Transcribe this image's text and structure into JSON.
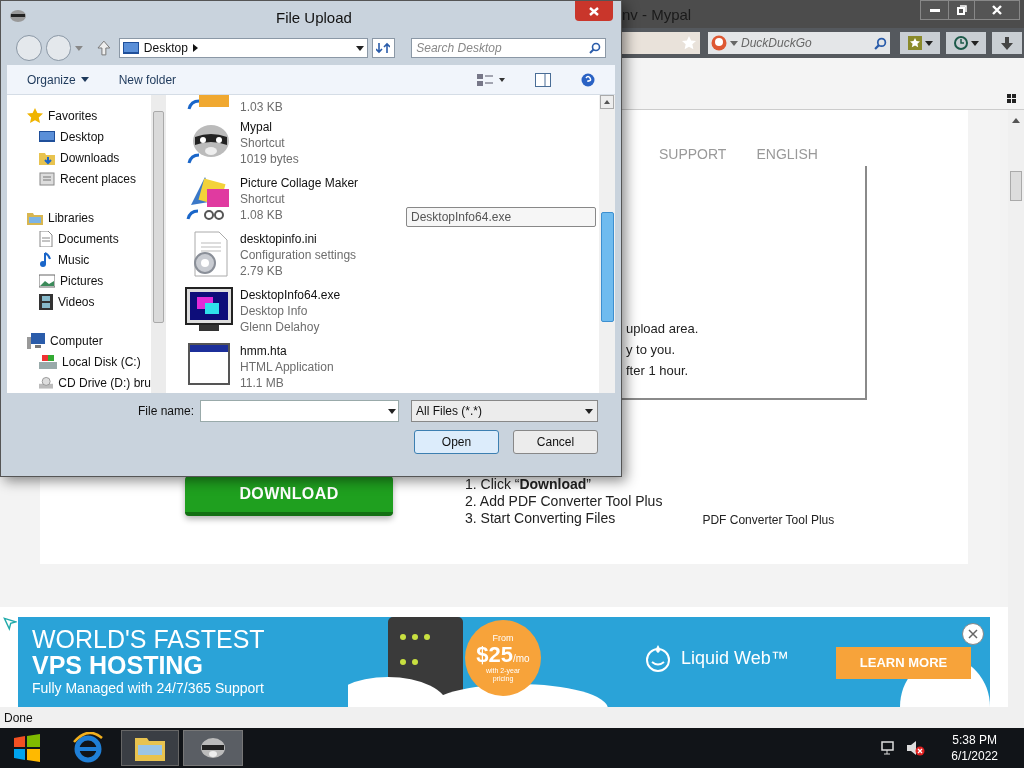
{
  "browser": {
    "title": "nv - Mypal",
    "search_placeholder": "DuckDuckGo"
  },
  "page": {
    "nav": [
      "SUPPORT",
      "ENGLISH"
    ],
    "box_lines": [
      "upload area.",
      "y to you.",
      "fter 1 hour."
    ],
    "download_button": "DOWNLOAD",
    "steps": [
      "1. Click “**Download**”",
      "2. Add PDF Converter Tool Plus",
      "3. Start Converting Files"
    ],
    "caption": "PDF Converter Tool Plus"
  },
  "ad": {
    "headline_1": "WORLD'S FASTEST",
    "headline_2": "VPS HOSTING",
    "subline": "Fully Managed with 24/7/365 Support",
    "price_from": "From",
    "price": "$25",
    "price_unit": "/mo",
    "price_note": "with 2-year pricing",
    "brand": "Liquid Web™",
    "cta": "LEARN MORE"
  },
  "status_bar": "Done",
  "taskbar": {
    "time": "5:38 PM",
    "date": "6/1/2022"
  },
  "dialog": {
    "title": "File Upload",
    "location": "Desktop",
    "search_placeholder": "Search Desktop",
    "toolbar": [
      "Organize",
      "New folder"
    ],
    "nav_pane": [
      {
        "label": "Favorites",
        "children": [
          {
            "label": "Desktop"
          },
          {
            "label": "Downloads"
          },
          {
            "label": "Recent places"
          }
        ]
      },
      {
        "label": "Libraries",
        "children": [
          {
            "label": "Documents"
          },
          {
            "label": "Music"
          },
          {
            "label": "Pictures"
          },
          {
            "label": "Videos"
          }
        ]
      },
      {
        "label": "Computer",
        "children": [
          {
            "label": "Local Disk (C:)"
          },
          {
            "label": "CD Drive (D:) bru"
          }
        ]
      }
    ],
    "files": [
      {
        "lines": [
          "1.03 KB"
        ]
      },
      {
        "lines": [
          "Mypal",
          "Shortcut",
          "1019 bytes"
        ]
      },
      {
        "lines": [
          "Picture Collage Maker",
          "Shortcut",
          "1.08 KB"
        ]
      },
      {
        "lines": [
          "desktopinfo.ini",
          "Configuration settings",
          "2.79 KB"
        ]
      },
      {
        "lines": [
          "DesktopInfo64.exe",
          "Desktop Info",
          "Glenn Delahoy"
        ]
      },
      {
        "lines": [
          "hmm.hta",
          "HTML Application",
          "11.1 MB"
        ]
      }
    ],
    "tooltip": "DesktopInfo64.exe",
    "file_name_label": "File name:",
    "file_type": "All Files (*.*)",
    "buttons": [
      "Open",
      "Cancel"
    ]
  }
}
